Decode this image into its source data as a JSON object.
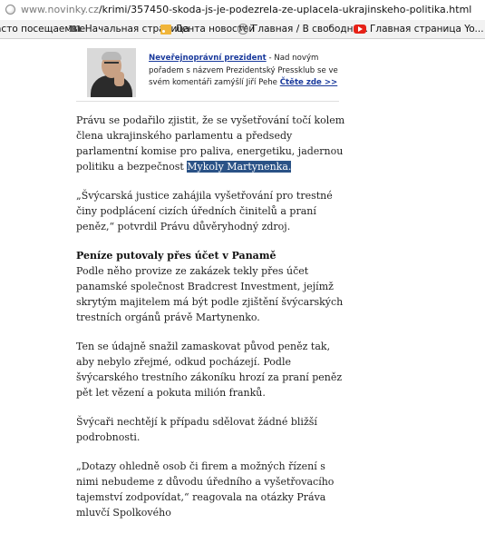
{
  "address_bar": {
    "host": "www.novinky.cz",
    "path": "/krimi/357450-skoda-js-je-podezrela-ze-uplacela-ukrajinskeho-politika.html",
    "icon": "globe-icon"
  },
  "bookmarks": [
    {
      "label": "асто посещаемые",
      "icon": ""
    },
    {
      "label": "Начальная страница",
      "icon": "m-logo-icon"
    },
    {
      "label": "Лента новостей",
      "icon": "rss-icon"
    },
    {
      "label": "Главная / В свободно...",
      "icon": "wikipedia-icon"
    },
    {
      "label": "Главная страница Yo...",
      "icon": "youtube-icon"
    }
  ],
  "promo": {
    "link_label": "Neveřejnoprávní prezident",
    "text": " - Nad novým pořadem s názvem Prezidentský Pressklub se ve svém komentáři zamýšlí Jiří Pehe ",
    "more_label": "Čtěte zde >>"
  },
  "article": {
    "p1": "Právu se podařilo zjistit, že se vyšetřování točí kolem člena ukrajinského parlamentu a předsedy parlamentní komise pro paliva, energetiku, jadernou politiku a bezpečnost ",
    "p1_selected": "Mykoly Martynenka.",
    "p2": "„Švýcarská justice zahájila vyšetřování pro trestné činy podplácení cizích úředních činitelů a praní peněz,“ potvrdil Právu důvěryhodný zdroj.",
    "heading": "Peníze putovaly přes účet v Panamě",
    "p3": "Podle něho provize ze zakázek tekly přes účet panamské společnost Bradcrest Investment, jejímž skrytým majitelem má být podle zjištění švýcarských trestních orgánů právě Martynenko.",
    "p4": "Ten se údajně snažil zamaskovat původ peněz tak, aby nebylo zřejmé, odkud pocházejí.  Podle švýcarského trestního zákoníku hrozí za praní peněz pět let vězení a pokuta milión franků.",
    "p5": "Švýcaři nechtějí k případu sdělovat žádné bližší podrobnosti.",
    "p6": "„Dotazy ohledně osob či firem a možných řízení s nimi nebudeme z důvodu úředního a vyšetřovacího tajemství zodpovídat,“ reagovala na otázky Práva mluvčí Spolkového"
  },
  "colors": {
    "link": "#1a3a9c",
    "selection": "#2a5286"
  }
}
